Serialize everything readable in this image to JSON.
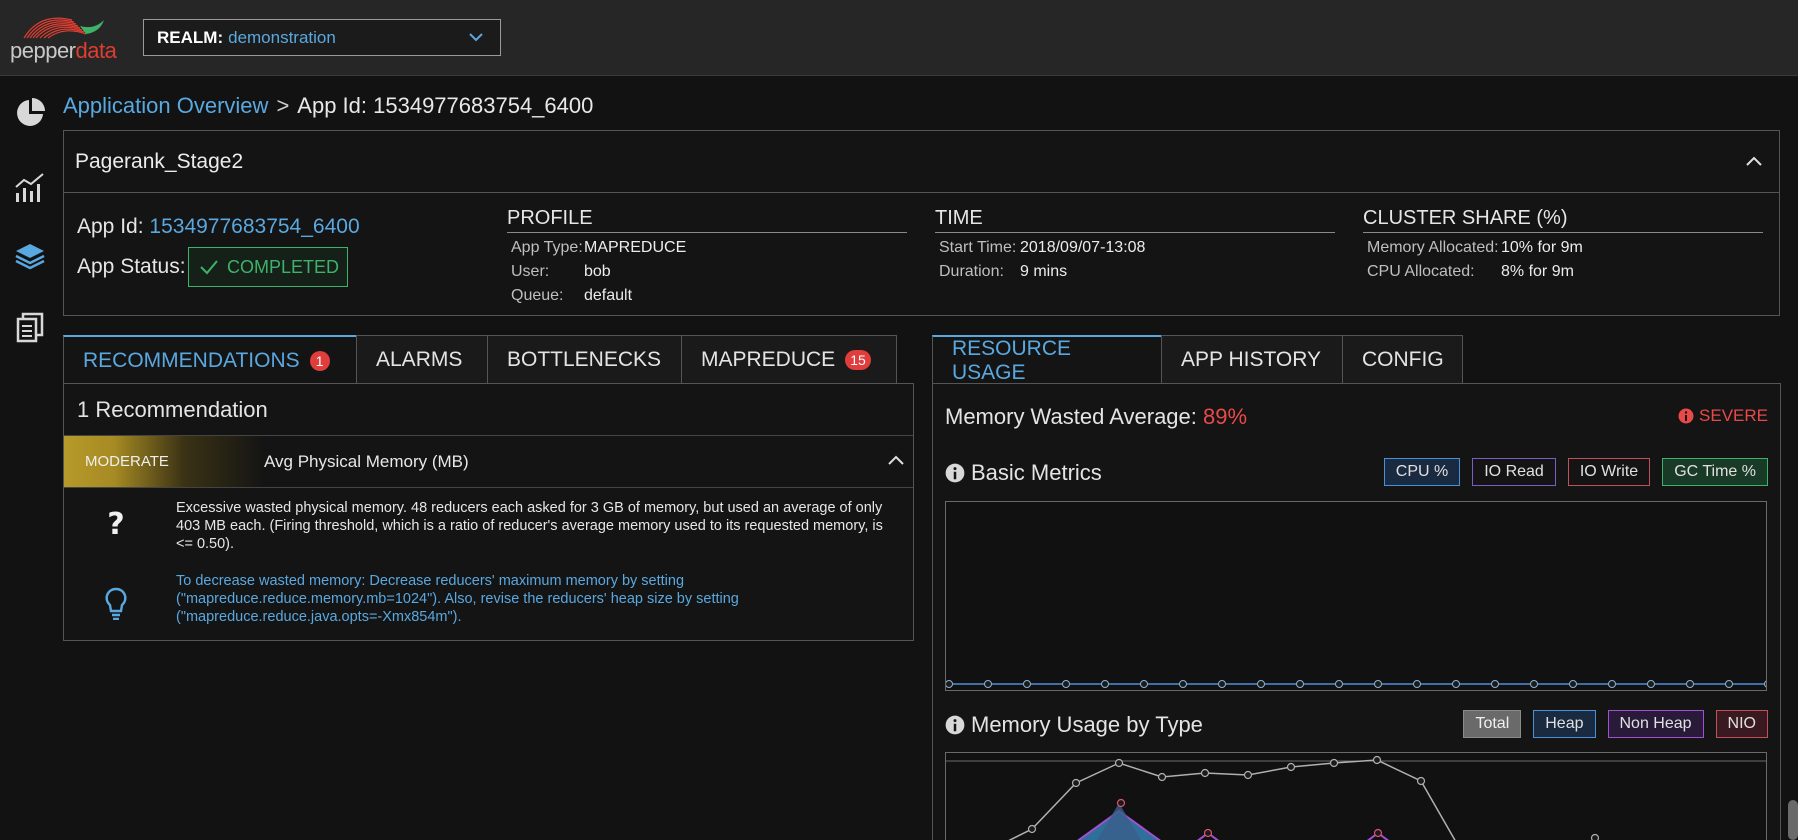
{
  "brand": {
    "word_part1": "pepper",
    "word_part2": "data"
  },
  "realm": {
    "label": "REALM:",
    "value": "demonstration"
  },
  "breadcrumb": {
    "parent": "Application Overview",
    "separator": ">",
    "current": "App Id: 1534977683754_6400"
  },
  "app": {
    "name": "Pagerank_Stage2",
    "id_label": "App Id:",
    "id_value": "1534977683754_6400",
    "status_label": "App Status:",
    "status_value": "COMPLETED"
  },
  "profile": {
    "title": "PROFILE",
    "rows": [
      {
        "k": "App Type:",
        "v": "MAPREDUCE"
      },
      {
        "k": "User:",
        "v": "bob"
      },
      {
        "k": "Queue:",
        "v": "default"
      }
    ]
  },
  "time": {
    "title": "TIME",
    "rows": [
      {
        "k": "Start Time:",
        "v": "2018/09/07-13:08"
      },
      {
        "k": "Duration:",
        "v": "9 mins"
      }
    ]
  },
  "cluster_share": {
    "title": "CLUSTER SHARE (%)",
    "rows": [
      {
        "k": "Memory Allocated:",
        "v": "10% for 9m"
      },
      {
        "k": "CPU Allocated:",
        "v": "8% for 9m"
      }
    ]
  },
  "left_tabs": [
    {
      "label": "RECOMMENDATIONS",
      "badge": "1"
    },
    {
      "label": "ALARMS"
    },
    {
      "label": "BOTTLENECKS"
    },
    {
      "label": "MAPREDUCE",
      "badge": "15"
    }
  ],
  "recommendations": {
    "count_text": "1 Recommendation",
    "severity": "MODERATE",
    "metric": "Avg Physical Memory (MB)",
    "explanation": "Excessive wasted physical memory. 48 reducers each asked for 3 GB of memory, but used an average of only 403 MB each. (Firing threshold, which is a ratio of reducer's average memory used to its requested memory, is <= 0.50).",
    "suggestion": "To decrease wasted memory: Decrease reducers' maximum memory by setting (\"mapreduce.reduce.memory.mb=1024\"). Also, revise the reducers' heap size by setting (\"mapreduce.reduce.java.opts=-Xmx854m\")."
  },
  "right_tabs": [
    {
      "label": "RESOURCE USAGE"
    },
    {
      "label": "APP HISTORY"
    },
    {
      "label": "CONFIG"
    }
  ],
  "resource": {
    "memory_wasted_label": "Memory Wasted Average:",
    "memory_wasted_value": "89%",
    "severity_label": "SEVERE",
    "basic_metrics_title": "Basic Metrics",
    "basic_legend": [
      {
        "label": "CPU %",
        "color": "#4a90d9"
      },
      {
        "label": "IO Read",
        "color": "#7a5fc0"
      },
      {
        "label": "IO Write",
        "color": "#c0505a"
      },
      {
        "label": "GC Time %",
        "color": "#3fb26a"
      }
    ],
    "memory_type_title": "Memory Usage by Type",
    "memory_legend": [
      {
        "label": "Total",
        "color": "#8a8a8a"
      },
      {
        "label": "Heap",
        "color": "#4a90d9"
      },
      {
        "label": "Non Heap",
        "color": "#a050d0"
      },
      {
        "label": "NIO",
        "color": "#c0505a"
      }
    ]
  },
  "icons": {
    "nav": [
      "pie-chart-icon",
      "bar-chart-icon",
      "layers-icon",
      "documents-icon"
    ],
    "status": "check-icon",
    "info": "info-icon",
    "question": "question-icon",
    "lightbulb": "lightbulb-icon"
  }
}
